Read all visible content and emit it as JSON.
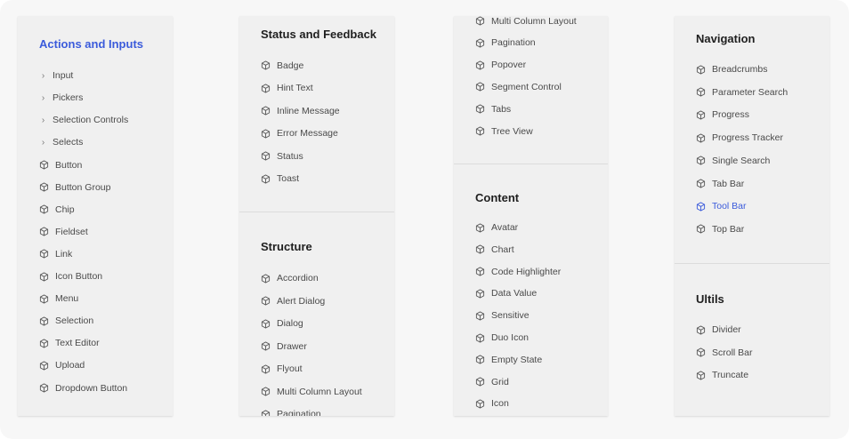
{
  "colors": {
    "accent": "#3b5bdb",
    "panel": "#f0f0f0",
    "text": "#4a4a4a"
  },
  "icons": {
    "item": "cube-icon",
    "group": "chevron-right-icon"
  },
  "actions_inputs": {
    "title": "Actions and Inputs",
    "groups": [
      "Input",
      "Pickers",
      "Selection Controls",
      "Selects"
    ],
    "items": [
      "Button",
      "Button Group",
      "Chip",
      "Fieldset",
      "Link",
      "Icon Button",
      "Menu",
      "Selection",
      "Text Editor",
      "Upload",
      "Dropdown Button"
    ]
  },
  "status_feedback": {
    "title": "Status and Feedback",
    "items": [
      "Badge",
      "Hint Text",
      "Inline Message",
      "Error Message",
      "Status",
      "Toast"
    ]
  },
  "structure": {
    "title": "Structure",
    "items": [
      "Accordion",
      "Alert Dialog",
      "Dialog",
      "Drawer",
      "Flyout",
      "Multi Column Layout",
      "Pagination"
    ]
  },
  "structure_cont": {
    "items": [
      "Multi Column Layout",
      "Pagination",
      "Popover",
      "Segment Control",
      "Tabs",
      "Tree View"
    ]
  },
  "content": {
    "title": "Content",
    "items": [
      "Avatar",
      "Chart",
      "Code Highlighter",
      "Data Value",
      "Sensitive",
      "Duo Icon",
      "Empty State",
      "Grid",
      "Icon"
    ]
  },
  "navigation": {
    "title": "Navigation",
    "items": [
      "Breadcrumbs",
      "Parameter Search",
      "Progress",
      "Progress Tracker",
      "Single Search",
      "Tab Bar",
      "Tool Bar",
      "Top Bar"
    ],
    "active": "Tool Bar"
  },
  "utils": {
    "title": "Ultils",
    "items": [
      "Divider",
      "Scroll Bar",
      "Truncate"
    ]
  }
}
